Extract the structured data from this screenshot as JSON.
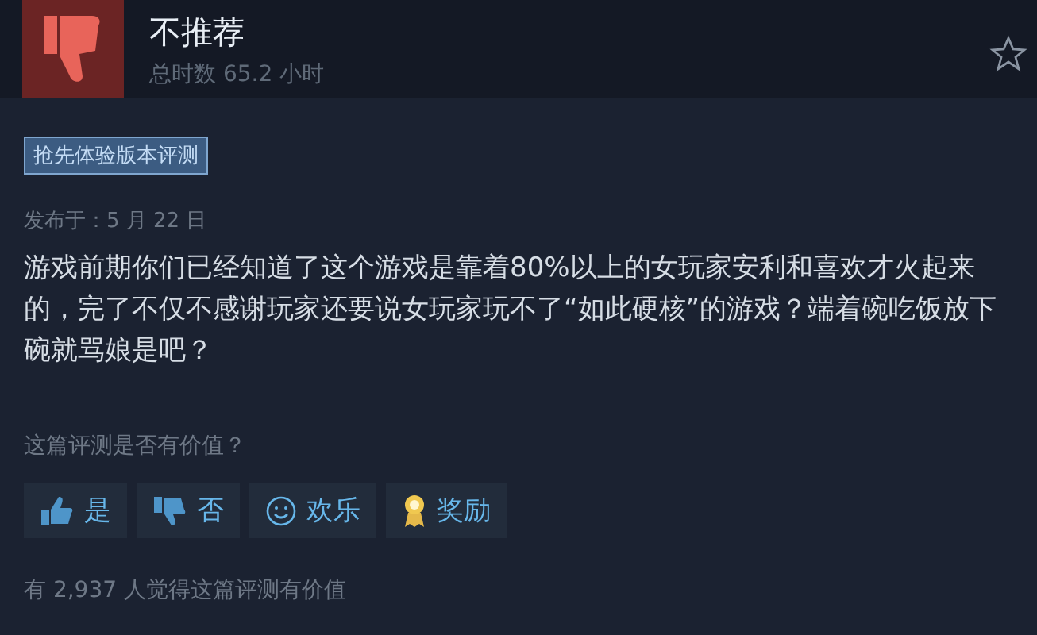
{
  "review": {
    "verdict": "不推荐",
    "playtime": "总时数 65.2 小时",
    "badge": "抢先体验版本评测",
    "posted": "发布于：5 月 22 日",
    "body": "游戏前期你们已经知道了这个游戏是靠着80%以上的女玩家安利和喜欢才火起来的，完了不仅不感谢玩家还要说女玩家玩不了“如此硬核”的游戏？端着碗吃饭放下碗就骂娘是吧？"
  },
  "feedback": {
    "question": "这篇评测是否有价值？",
    "buttons": [
      {
        "kind": "yes",
        "label": "是"
      },
      {
        "kind": "no",
        "label": "否"
      },
      {
        "kind": "funny",
        "label": "欢乐"
      },
      {
        "kind": "award",
        "label": "奖励"
      }
    ],
    "summary": "有 2,937 人觉得这篇评测有价值"
  }
}
